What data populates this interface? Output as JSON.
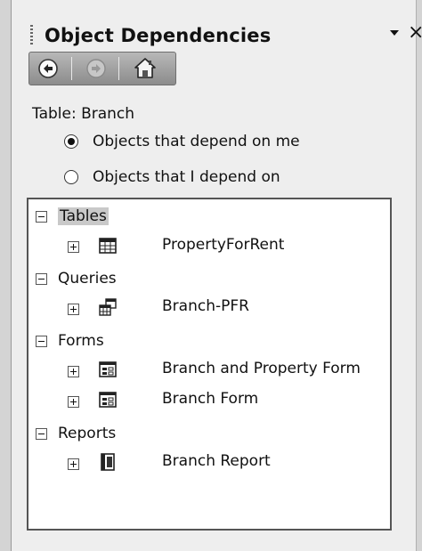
{
  "panel": {
    "title": "Object Dependencies",
    "dropdown_icon": "triangle-down-icon",
    "close_label": "×"
  },
  "nav": {
    "back_icon": "back-arrow-icon",
    "forward_icon": "forward-arrow-icon",
    "home_icon": "home-icon"
  },
  "subject": {
    "label": "Table: Branch"
  },
  "options": [
    {
      "label": "Objects that depend on me",
      "selected": true
    },
    {
      "label": "Objects that I depend on",
      "selected": false
    }
  ],
  "tree": {
    "groups": [
      {
        "label": "Tables",
        "selected": true,
        "items": [
          {
            "label": "PropertyForRent",
            "icon": "table-icon"
          }
        ]
      },
      {
        "label": "Queries",
        "selected": false,
        "items": [
          {
            "label": "Branch-PFR",
            "icon": "query-icon"
          }
        ]
      },
      {
        "label": "Forms",
        "selected": false,
        "items": [
          {
            "label": "Branch and Property Form",
            "icon": "form-icon"
          },
          {
            "label": "Branch Form",
            "icon": "form-icon"
          }
        ]
      },
      {
        "label": "Reports",
        "selected": false,
        "items": [
          {
            "label": "Branch Report",
            "icon": "report-icon"
          }
        ]
      }
    ]
  }
}
